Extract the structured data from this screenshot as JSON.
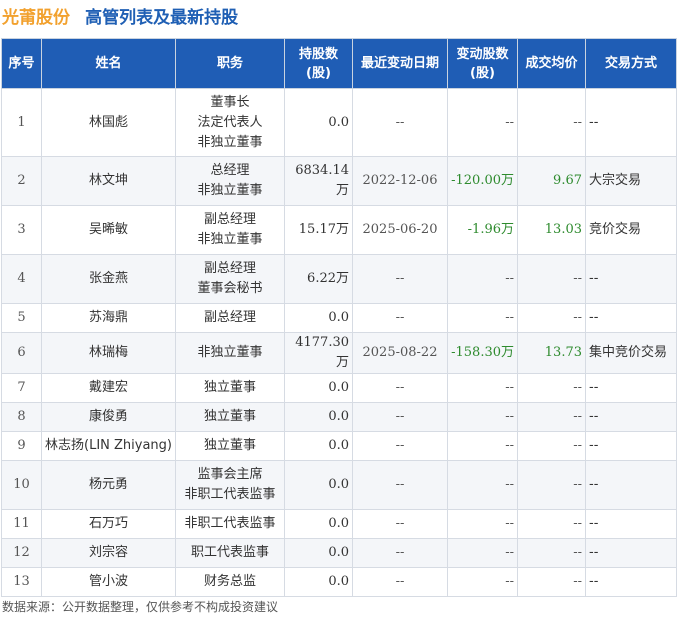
{
  "header": {
    "company": "光莆股份",
    "subtitle": "高管列表及最新持股"
  },
  "table": {
    "columns": [
      "序号",
      "姓名",
      "职务",
      "持股数\n(股)",
      "最近变动日期",
      "变动股数\n(股)",
      "成交均价",
      "交易方式"
    ],
    "rows": [
      {
        "no": "1",
        "name": "林国彪",
        "positions": [
          "董事长",
          "法定代表人",
          "非独立董事"
        ],
        "holding": "0.0",
        "date": "--",
        "change": "--",
        "price": "--",
        "method": "--"
      },
      {
        "no": "2",
        "name": "林文坤",
        "positions": [
          "总经理",
          "非独立董事"
        ],
        "holding": "6834.14万",
        "date": "2022-12-06",
        "change": "-120.00万",
        "price": "9.67",
        "method": "大宗交易"
      },
      {
        "no": "3",
        "name": "吴晞敏",
        "positions": [
          "副总经理",
          "非独立董事"
        ],
        "holding": "15.17万",
        "date": "2025-06-20",
        "change": "-1.96万",
        "price": "13.03",
        "method": "竞价交易"
      },
      {
        "no": "4",
        "name": "张金燕",
        "positions": [
          "副总经理",
          "董事会秘书"
        ],
        "holding": "6.22万",
        "date": "--",
        "change": "--",
        "price": "--",
        "method": "--"
      },
      {
        "no": "5",
        "name": "苏海鼎",
        "positions": [
          "副总经理"
        ],
        "holding": "0.0",
        "date": "--",
        "change": "--",
        "price": "--",
        "method": "--"
      },
      {
        "no": "6",
        "name": "林瑞梅",
        "positions": [
          "非独立董事"
        ],
        "holding": "4177.30万",
        "date": "2025-08-22",
        "change": "-158.30万",
        "price": "13.73",
        "method": "集中竞价交易"
      },
      {
        "no": "7",
        "name": "戴建宏",
        "positions": [
          "独立董事"
        ],
        "holding": "0.0",
        "date": "--",
        "change": "--",
        "price": "--",
        "method": "--"
      },
      {
        "no": "8",
        "name": "康俊勇",
        "positions": [
          "独立董事"
        ],
        "holding": "0.0",
        "date": "--",
        "change": "--",
        "price": "--",
        "method": "--"
      },
      {
        "no": "9",
        "name": "林志扬(LIN Zhiyang)",
        "positions": [
          "独立董事"
        ],
        "holding": "0.0",
        "date": "--",
        "change": "--",
        "price": "--",
        "method": "--"
      },
      {
        "no": "10",
        "name": "杨元勇",
        "positions": [
          "监事会主席",
          "非职工代表监事"
        ],
        "holding": "0.0",
        "date": "--",
        "change": "--",
        "price": "--",
        "method": "--"
      },
      {
        "no": "11",
        "name": "石万巧",
        "positions": [
          "非职工代表监事"
        ],
        "holding": "0.0",
        "date": "--",
        "change": "--",
        "price": "--",
        "method": "--"
      },
      {
        "no": "12",
        "name": "刘宗容",
        "positions": [
          "职工代表监事"
        ],
        "holding": "0.0",
        "date": "--",
        "change": "--",
        "price": "--",
        "method": "--"
      },
      {
        "no": "13",
        "name": "管小波",
        "positions": [
          "财务总监"
        ],
        "holding": "0.0",
        "date": "--",
        "change": "--",
        "price": "--",
        "method": "--"
      }
    ]
  },
  "footer": {
    "source": "数据来源：公开数据整理，仅供参考不构成投资建议"
  },
  "colors": {
    "header_bg": "#1f5db5",
    "company": "#f2a12e",
    "subtitle": "#1f5fb4",
    "negative": "#2e8b2e"
  }
}
